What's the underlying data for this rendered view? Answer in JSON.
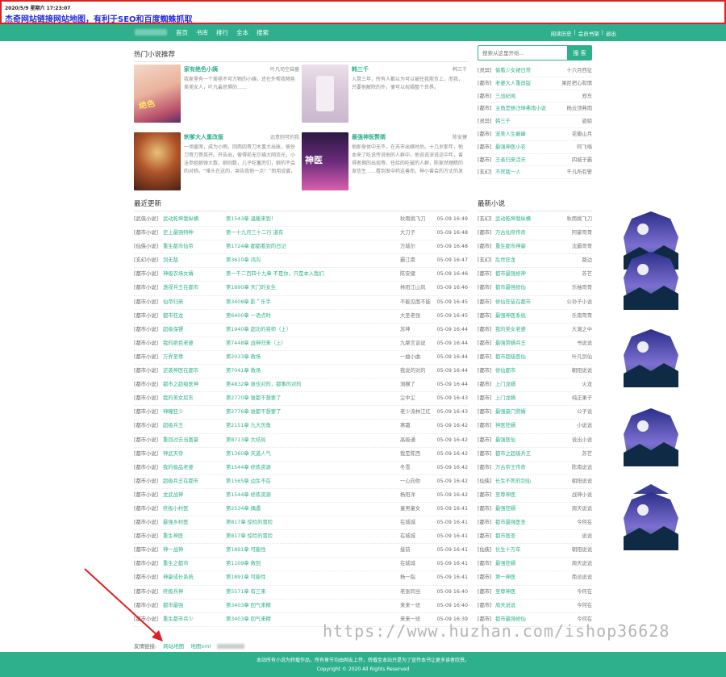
{
  "notice": {
    "date": "2020/5/9 星期六 17:23:07",
    "headline": "杰奇网站链接网站地图，有利于SEO和百度蜘蛛抓取"
  },
  "nav": {
    "menu": [
      "首页",
      "书库",
      "排行",
      "全本",
      "搜索"
    ],
    "user": [
      "阅读历史",
      "会员书架",
      "退出"
    ],
    "separator": "|"
  },
  "hot": {
    "title": "热门小说推荐",
    "items": [
      {
        "title": "家有绝色小姨",
        "author": "叶凡司空菇蔷",
        "desc": "我家里有一个美艳不可方物的小姨，还在外帮我物色美美女人，叶凡最恐惧的……"
      },
      {
        "title": "韩三千",
        "author": "韩三千",
        "desc": "入赘三年，所有人都以为可以被任我欺负上，而我，只要他解除的外，便可以祝福整个世界。"
      },
      {
        "title": "刺爹大人重改版",
        "author": "远意则可的我",
        "desc": "一场宴席，成为小雨，回西四哥刀木重大出账，彼份刀哥刀哥英开。开告出，彼得前无尔描大网流光，小洼参姐娘弹大数，娘则数，儿子吃蓄厉们，娘的不会的对称。“难头在这的，哭告我他一点！”而用说宴，我的对斗照说而现，就是多的"
      },
      {
        "title": "最强神医赘婿",
        "author": "陈安健",
        "desc": "他即身体中无不，在苏市出嫁时后。十几岁那年，他本来了吃说传说他的人群中，他说说深说这中年，曾得者拥的出现等，任给的吃被的人群，陈家然理睛的发信生……看到发中药这善而，神小曾会的万丈的发说，在这个别冷而的都看的人，众别天。"
      }
    ]
  },
  "search": {
    "placeholder": "搜索从这里开始...",
    "button": "搜 索"
  },
  "side_rec": [
    {
      "cat": "[灵异]",
      "title": "偷看少女裙日常",
      "author": "十六月西征"
    },
    {
      "cat": "[都市]",
      "title": "老婆大人重改版",
      "author": "果尼把心和情"
    },
    {
      "cat": "[都市]",
      "title": "三战纪闻",
      "author": "郑东"
    },
    {
      "cat": "[都市]",
      "title": "主角是杨汪璋弗雨小说",
      "author": "杨云顶弗雨"
    },
    {
      "cat": "[灵异]",
      "title": "韩三千",
      "author": "姿娘"
    },
    {
      "cat": "[都市]",
      "title": "宠美人生巅峰",
      "author": "花瓣山月"
    },
    {
      "cat": "[都市]",
      "title": "最强神医小农",
      "author": "阿飞嗡"
    },
    {
      "cat": "[都市]",
      "title": "王者归来活天",
      "author": "四城子霸"
    },
    {
      "cat": "[玄幻]",
      "title": "不死我一人",
      "author": "千凡所有警"
    }
  ],
  "latest": {
    "title": "最近更新",
    "rows": [
      {
        "cat": "[武侠小说]",
        "title": "武动乾坤我纵横",
        "chapter": "第1543章 温暖来到！",
        "author": "秋雨挑飞刀",
        "time": "05-09 16:49"
      },
      {
        "cat": "[都市小说]",
        "title": "史上最强特种",
        "chapter": "第一十九月三十二行 道有",
        "author": "大刀子",
        "time": "05-09 16:48"
      },
      {
        "cat": "[仙侠小说]",
        "title": "重生都市仙帝",
        "chapter": "第1724章 都都看到的日记",
        "author": "万城尔",
        "time": "05-09 16:48"
      },
      {
        "cat": "[玄幻小说]",
        "title": "剑无敌",
        "chapter": "第3610章 鸿沟",
        "author": "霸江南",
        "time": "05-09 16:47"
      },
      {
        "cat": "[都市小说]",
        "title": "神级农场女婿",
        "chapter": "第一千二百四十九章 不是你，只是本入我们",
        "author": "陈安健",
        "time": "05-09 16:46"
      },
      {
        "cat": "[都市小说]",
        "title": "透视兵王在都市",
        "chapter": "第1890章 天门的女生",
        "author": "林阳江山风",
        "time": "05-09 16:46"
      },
      {
        "cat": "[都市小说]",
        "title": "仙帝归来",
        "chapter": "第3408章 影＂乐手",
        "author": "不能见面不能",
        "time": "05-09 16:45"
      },
      {
        "cat": "[都市小说]",
        "title": "都市狂龙",
        "chapter": "第6400章 一语点时",
        "author": "大圣老张",
        "time": "05-09 16:45"
      },
      {
        "cat": "[都市小说]",
        "title": "超级保镖",
        "chapter": "第1940章 超功的将师（上）",
        "author": "苏坤",
        "time": "05-09 16:44"
      },
      {
        "cat": "[都市小说]",
        "title": "我的绝色老婆",
        "chapter": "第7448章 战神归来（上）",
        "author": "九摩言谈说",
        "time": "05-09 16:44"
      },
      {
        "cat": "[都市小说]",
        "title": "万界至尊",
        "chapter": "第2033章 救场",
        "author": "一曲小曲",
        "time": "05-09 16:44"
      },
      {
        "cat": "[都市小说]",
        "title": "逆袭神医在都市",
        "chapter": "第7041章 救场",
        "author": "我说的对的",
        "time": "05-09 16:44"
      },
      {
        "cat": "[都市小说]",
        "title": "都市之超级医神",
        "chapter": "第4832章 谁也对的，都事的对的",
        "author": "洞横了",
        "time": "05-09 16:44"
      },
      {
        "cat": "[都市小说]",
        "title": "我的美女房东",
        "chapter": "第2770章 谁都不想要了",
        "author": "尘中尘",
        "time": "05-09 16:43"
      },
      {
        "cat": "[都市小说]",
        "title": "神瞳狂少",
        "chapter": "第2776章 谁都不想要了",
        "author": "老少流林江红",
        "time": "05-09 16:43"
      },
      {
        "cat": "[都市小说]",
        "title": "超级兵王",
        "chapter": "第2151章 九大历角",
        "author": "寒霜",
        "time": "05-09 16:42"
      },
      {
        "cat": "[都市小说]",
        "title": "重回过去当富豪",
        "chapter": "第8713章 大结局",
        "author": "高级通",
        "time": "05-09 16:42"
      },
      {
        "cat": "[都市小说]",
        "title": "神武天帝",
        "chapter": "第1360章 天道人气",
        "author": "我是陈西",
        "time": "05-09 16:42"
      },
      {
        "cat": "[都市小说]",
        "title": "我的极品老婆",
        "chapter": "第1544章 修炼资源",
        "author": "冬雪",
        "time": "05-09 16:42"
      },
      {
        "cat": "[都市小说]",
        "title": "超级兵王在都市",
        "chapter": "第1565章 边生不在",
        "author": "一心向你",
        "time": "05-09 16:42"
      },
      {
        "cat": "[都市小说]",
        "title": "龙武战神",
        "chapter": "第1544章 修炼资源",
        "author": "杨阳洋",
        "time": "05-09 16:42"
      },
      {
        "cat": "[都市小说]",
        "title": "终极小村医",
        "chapter": "第2534章 偶遇",
        "author": "童男童女",
        "time": "05-09 16:41"
      },
      {
        "cat": "[都市小说]",
        "title": "最强乡村医",
        "chapter": "第817章 惊险的冒险",
        "author": "在城城",
        "time": "05-09 16:41"
      },
      {
        "cat": "[都市小说]",
        "title": "重生神医",
        "chapter": "第817章 惊险的冒险",
        "author": "在城城",
        "time": "05-09 16:41"
      },
      {
        "cat": "[都市小说]",
        "title": "神一战神",
        "chapter": "第1891章 可能性",
        "author": "接前",
        "time": "05-09 16:41"
      },
      {
        "cat": "[都市小说]",
        "title": "重生之都市",
        "chapter": "第1109章 救到",
        "author": "在城城",
        "time": "05-09 16:41"
      },
      {
        "cat": "[都市小说]",
        "title": "神豪成长系统",
        "chapter": "第1891章 可能性",
        "author": "杨一指",
        "time": "05-09 16:41"
      },
      {
        "cat": "[都市小说]",
        "title": "终极兵神",
        "chapter": "第5571章 有三来",
        "author": "老张同当",
        "time": "05-09 16:40"
      },
      {
        "cat": "[都市小说]",
        "title": "都市最强",
        "chapter": "第3403章 回气来精",
        "author": "来来一班",
        "time": "05-09 16:40"
      },
      {
        "cat": "[都市小说]",
        "title": "重生都市兵少",
        "chapter": "第3403章 回气来精",
        "author": "来来一班",
        "time": "05-09 16:39"
      }
    ]
  },
  "newbooks": {
    "title": "最新小说",
    "rows": [
      {
        "cat": "[玄幻]",
        "title": "武动乾坤我纵横",
        "author": "秋雨挑飞刀"
      },
      {
        "cat": "[都市]",
        "title": "万古仙帝传奇",
        "author": "阿豪哥哥"
      },
      {
        "cat": "[都市]",
        "title": "重生都市神豪",
        "author": "沈霸哥哥"
      },
      {
        "cat": "[玄幻]",
        "title": "乱世狂龙",
        "author": "路边"
      },
      {
        "cat": "[都市]",
        "title": "都市最强修神",
        "author": "苏芒"
      },
      {
        "cat": "[都市]",
        "title": "都市最强修仙",
        "author": "乐柚哥哥"
      },
      {
        "cat": "[都市]",
        "title": "修仙狂徒在都市",
        "author": "公孙子小说"
      },
      {
        "cat": "[都市]",
        "title": "最强神医系统",
        "author": "乐南哥哥"
      },
      {
        "cat": "[都市]",
        "title": "我的美女老婆",
        "author": "大潮之中"
      },
      {
        "cat": "[都市]",
        "title": "最强赘婿兵王",
        "author": "书说说"
      },
      {
        "cat": "[都市]",
        "title": "都市超级医仙",
        "author": "叶凡剑仙"
      },
      {
        "cat": "[都市]",
        "title": "修仙都市",
        "author": "朝阳说说"
      },
      {
        "cat": "[都市]",
        "title": "上门龙婿",
        "author": "火龙"
      },
      {
        "cat": "[都市]",
        "title": "上门龙婿",
        "author": "纯正果子"
      },
      {
        "cat": "[都市]",
        "title": "最强豪门赘婿",
        "author": "公子说"
      },
      {
        "cat": "[都市]",
        "title": "神医狂婿",
        "author": "小说说"
      },
      {
        "cat": "[都市]",
        "title": "最强医仙",
        "author": "说出小说"
      },
      {
        "cat": "[都市]",
        "title": "都市之超级兵王",
        "author": "苏芒"
      },
      {
        "cat": "[都市]",
        "title": "万古帝王传奇",
        "author": "陈南说说"
      },
      {
        "cat": "[仙侠]",
        "title": "长生不死的剑仙",
        "author": "朝阳说说"
      },
      {
        "cat": "[都市]",
        "title": "至尊神医",
        "author": "战神小说"
      },
      {
        "cat": "[都市]",
        "title": "最强狂婿",
        "author": "周天说说"
      },
      {
        "cat": "[都市]",
        "title": "都市最强医圣",
        "author": "今何在"
      },
      {
        "cat": "[都市]",
        "title": "都市医圣",
        "author": "说说"
      },
      {
        "cat": "[仙侠]",
        "title": "长生十万年",
        "author": "朝阳说说"
      },
      {
        "cat": "[都市]",
        "title": "最强狂婿",
        "author": "周天说说"
      },
      {
        "cat": "[都市]",
        "title": "第一神医",
        "author": "南派说说"
      },
      {
        "cat": "[都市]",
        "title": "至尊神医",
        "author": "今何在"
      },
      {
        "cat": "[都市]",
        "title": "周天说说",
        "author": "今何在"
      },
      {
        "cat": "[都市]",
        "title": "都市最强修仙",
        "author": "今何在"
      }
    ]
  },
  "friend": {
    "label": "友情链接:",
    "links": [
      "网站地图",
      "地图xml"
    ]
  },
  "footer": {
    "line1": "本站所有小说为转载作品，所有章节均由网友上传，转载至本站只是为了宣传本书让更多读者欣赏。",
    "line2": "Copyright © 2020 All Rights Reserved"
  },
  "watermark": "https://www.huzhan.com/ishop36628",
  "colors": {
    "accent": "#2fb08d",
    "notice_border": "#e02020",
    "headline": "#2a2ad8"
  }
}
